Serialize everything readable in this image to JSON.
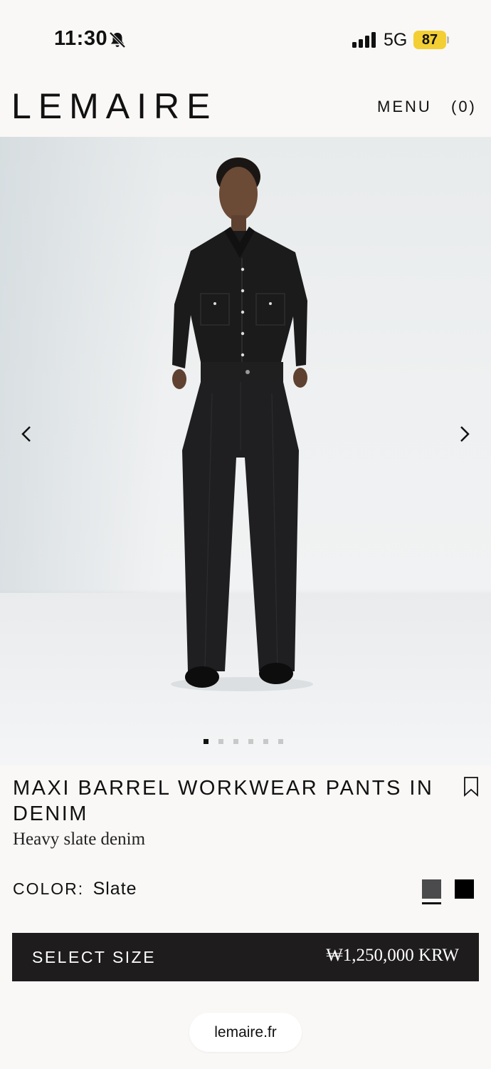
{
  "status_bar": {
    "time": "11:30",
    "network": "5G",
    "battery": "87",
    "bell_icon": "bell-slash-icon",
    "signal_icon": "signal-bars-icon",
    "battery_color": "#f3cf33"
  },
  "header": {
    "logo": "LEMAIRE",
    "menu_label": "MENU",
    "cart_label": "(0)"
  },
  "gallery": {
    "prev_icon": "chevron-left-icon",
    "next_icon": "chevron-right-icon",
    "image_count": 6,
    "active_index": 0
  },
  "product": {
    "title": "MAXI BARREL WORKWEAR PANTS IN DENIM",
    "subtitle": "Heavy slate denim",
    "bookmark_icon": "bookmark-icon",
    "color_label": "COLOR:",
    "color_value": "Slate",
    "swatches": [
      {
        "name": "Slate",
        "color": "#4b4b4d",
        "selected": true
      },
      {
        "name": "Black",
        "color": "#000000",
        "selected": false
      }
    ],
    "select_size_label": "SELECT SIZE",
    "price": "₩1,250,000 KRW"
  },
  "browser": {
    "url": "lemaire.fr"
  }
}
